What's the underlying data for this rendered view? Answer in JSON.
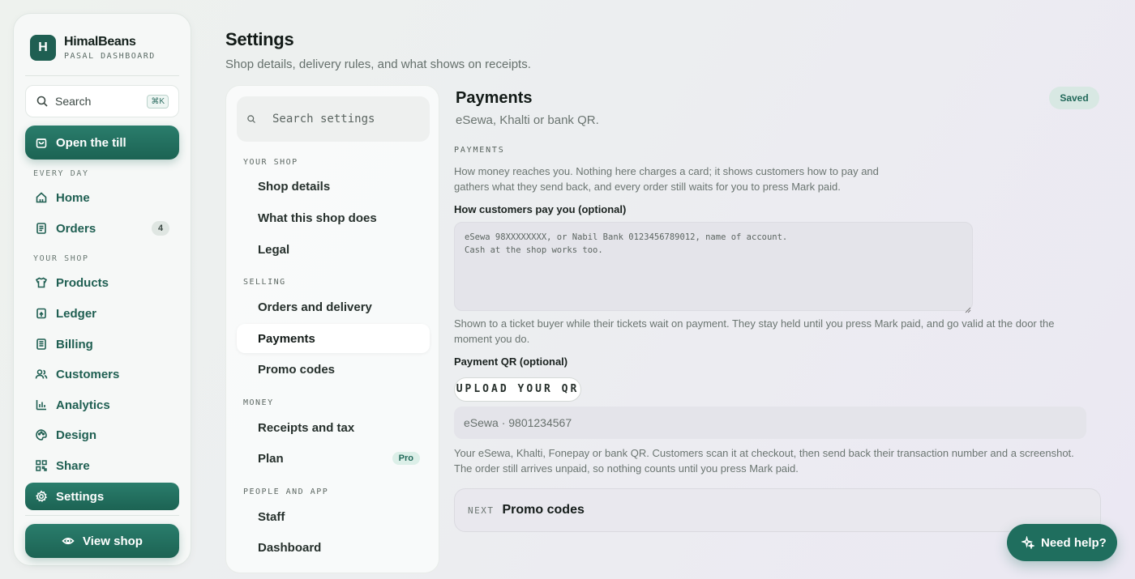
{
  "brand": {
    "logo_letter": "H",
    "name": "HimalBeans",
    "subtitle": "PASAL DASHBOARD"
  },
  "sidebar": {
    "search_label": "Search",
    "search_shortcut": "⌘K",
    "cta_label": "Open the till",
    "section_every_day": "EVERY DAY",
    "section_your_shop": "YOUR SHOP",
    "items": [
      {
        "label": "Home",
        "icon": "home-icon"
      },
      {
        "label": "Orders",
        "icon": "receipt-icon",
        "badge": "4"
      },
      {
        "label": "Products",
        "icon": "shirt-icon"
      },
      {
        "label": "Ledger",
        "icon": "ledger-icon"
      },
      {
        "label": "Billing",
        "icon": "billing-icon"
      },
      {
        "label": "Customers",
        "icon": "users-icon"
      },
      {
        "label": "Analytics",
        "icon": "chart-icon"
      },
      {
        "label": "Design",
        "icon": "palette-icon"
      },
      {
        "label": "Share",
        "icon": "qr-icon"
      },
      {
        "label": "Settings",
        "icon": "gear-icon",
        "active": true
      }
    ],
    "view_shop_label": "View shop"
  },
  "page": {
    "title": "Settings",
    "subtitle": "Shop details, delivery rules, and what shows on receipts."
  },
  "settings_nav": {
    "search_placeholder": "Search settings",
    "sections": {
      "your_shop": "YOUR SHOP",
      "selling": "SELLING",
      "money": "MONEY",
      "people": "PEOPLE AND APP"
    },
    "items": {
      "shop_details": "Shop details",
      "what_shop_does": "What this shop does",
      "legal": "Legal",
      "orders_delivery": "Orders and delivery",
      "payments": "Payments",
      "promo_codes": "Promo codes",
      "receipts_tax": "Receipts and tax",
      "plan": "Plan",
      "plan_badge": "Pro",
      "staff": "Staff",
      "dashboard": "Dashboard"
    }
  },
  "content": {
    "title": "Payments",
    "subtitle": "eSewa, Khalti or bank QR.",
    "status": "Saved",
    "section_label": "PAYMENTS",
    "intro": "How money reaches you. Nothing here charges a card; it shows customers how to pay and gathers what they send back, and every order still waits for you to press Mark paid.",
    "how_pay_label": "How customers pay you (optional)",
    "how_pay_placeholder": "eSewa 98XXXXXXXX, or Nabil Bank 0123456789012, name of account.\nCash at the shop works too.",
    "how_pay_help": "Shown to a ticket buyer while their tickets wait on payment. They stay held until you press Mark paid, and go valid at the door the moment you do.",
    "qr_label": "Payment QR (optional)",
    "upload_label": "UPLOAD YOUR QR",
    "qr_placeholder": "eSewa · 9801234567",
    "qr_help": "Your eSewa, Khalti, Fonepay or bank QR. Customers scan it at checkout, then send back their transaction number and a screenshot. The order still arrives unpaid, so nothing counts until you press Mark paid.",
    "next_label": "NEXT",
    "next_title": "Promo codes"
  },
  "help_button": "Need help?",
  "colors": {
    "accent": "#1f5f52",
    "accent_light": "#2a7d6c",
    "badge_bg": "#d8e8e3"
  }
}
